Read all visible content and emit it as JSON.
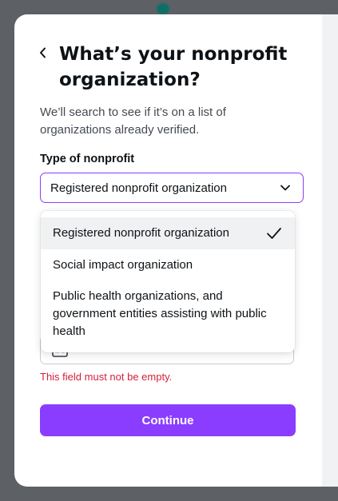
{
  "dialog": {
    "title": "What’s your nonprofit organization?",
    "subtitle": "We’ll search to see if it’s on a list of organizations already verified."
  },
  "type_field": {
    "label": "Type of nonprofit",
    "selected_value": "Registered nonprofit organization",
    "icon": "chevron-down-icon"
  },
  "dropdown": {
    "options": [
      {
        "label": "Registered nonprofit organization",
        "selected": true
      },
      {
        "label": "Social impact organization",
        "selected": false
      },
      {
        "label": "Public health organizations, and government entities assisting with public health",
        "selected": false
      }
    ]
  },
  "org_field": {
    "icon": "building-card-icon",
    "visible_text": ""
  },
  "error_message": "This field must not be empty.",
  "continue_label": "Continue",
  "colors": {
    "accent": "#8b3dff",
    "error": "#d4213d",
    "backdrop": "#5d6166"
  }
}
